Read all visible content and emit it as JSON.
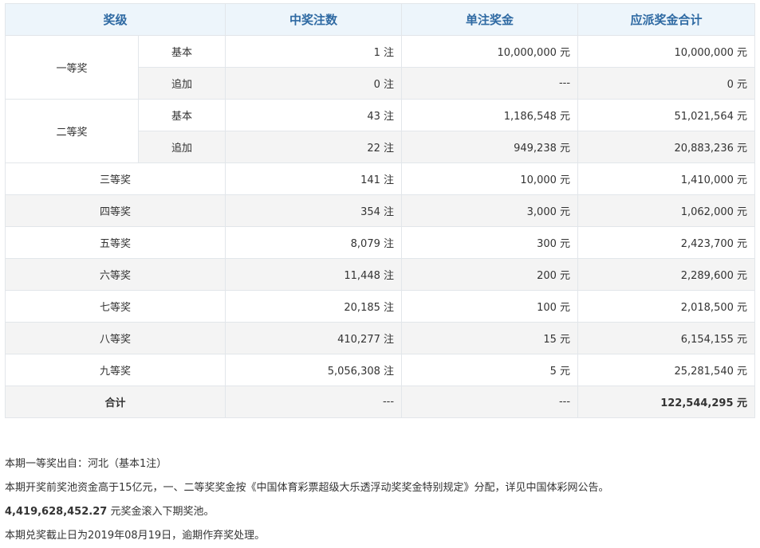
{
  "headers": {
    "level": "奖级",
    "count": "中奖注数",
    "single": "单注奖金",
    "total": "应派奖金合计"
  },
  "first": {
    "name": "一等奖",
    "basic": {
      "sub": "基本",
      "count": "1 注",
      "single": "10,000,000 元",
      "total": "10,000,000 元"
    },
    "extra": {
      "sub": "追加",
      "count": "0 注",
      "single": "---",
      "total": "0 元"
    }
  },
  "second": {
    "name": "二等奖",
    "basic": {
      "sub": "基本",
      "count": "43 注",
      "single": "1,186,548 元",
      "total": "51,021,564 元"
    },
    "extra": {
      "sub": "追加",
      "count": "22 注",
      "single": "949,238 元",
      "total": "20,883,236 元"
    }
  },
  "rows": [
    {
      "name": "三等奖",
      "count": "141 注",
      "single": "10,000 元",
      "total": "1,410,000 元"
    },
    {
      "name": "四等奖",
      "count": "354 注",
      "single": "3,000 元",
      "total": "1,062,000 元"
    },
    {
      "name": "五等奖",
      "count": "8,079 注",
      "single": "300 元",
      "total": "2,423,700 元"
    },
    {
      "name": "六等奖",
      "count": "11,448 注",
      "single": "200 元",
      "total": "2,289,600 元"
    },
    {
      "name": "七等奖",
      "count": "20,185 注",
      "single": "100 元",
      "total": "2,018,500 元"
    },
    {
      "name": "八等奖",
      "count": "410,277 注",
      "single": "15 元",
      "total": "6,154,155 元"
    },
    {
      "name": "九等奖",
      "count": "5,056,308 注",
      "single": "5 元",
      "total": "25,281,540 元"
    }
  ],
  "sum": {
    "name": "合计",
    "count": "---",
    "single": "---",
    "total": "122,544,295 元"
  },
  "notes": {
    "origin": "本期一等奖出自：河北（基本1注）",
    "rule": "本期开奖前奖池资金高于15亿元，一、二等奖奖金按《中国体育彩票超级大乐透浮动奖奖金特别规定》分配，详见中国体彩网公告。",
    "pool_amount": "4,419,628,452.27",
    "pool_text": " 元奖金滚入下期奖池。",
    "deadline": "本期兑奖截止日为2019年08月19日，逾期作弃奖处理。"
  }
}
